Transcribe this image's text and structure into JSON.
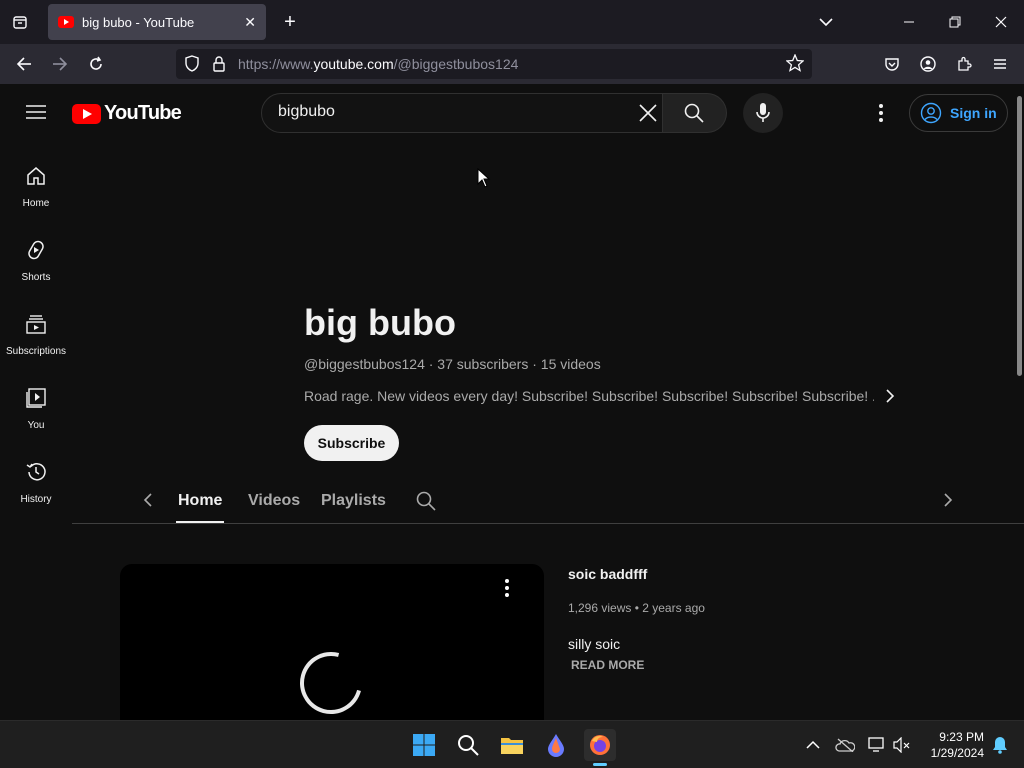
{
  "browser": {
    "tab_title": "big bubo - YouTube",
    "url_prefix": "https://www.",
    "url_domain": "youtube.com",
    "url_path": "/@biggestbubos124"
  },
  "youtube": {
    "logo_text": "YouTube",
    "search_value": "bigbubo",
    "sign_in_label": "Sign in",
    "sidebar": [
      {
        "label": "Home",
        "icon": "home-icon"
      },
      {
        "label": "Shorts",
        "icon": "shorts-icon"
      },
      {
        "label": "Subscriptions",
        "icon": "subscriptions-icon"
      },
      {
        "label": "You",
        "icon": "you-icon"
      },
      {
        "label": "History",
        "icon": "history-icon"
      }
    ],
    "channel": {
      "name": "big bubo",
      "meta": "@biggestbubos124 · 37 subscribers · 15 videos",
      "description": "Road rage. New videos every day! Subscribe! Subscribe! Subscribe! Subscribe! Subscribe! ...",
      "subscribe_label": "Subscribe"
    },
    "tabs": [
      "Home",
      "Videos",
      "Playlists"
    ],
    "video": {
      "title": "soic baddfff",
      "meta": "1,296 views • 2 years ago",
      "description": "silly soic",
      "read_more": "READ MORE"
    }
  },
  "taskbar": {
    "time": "9:23 PM",
    "date": "1/29/2024"
  }
}
